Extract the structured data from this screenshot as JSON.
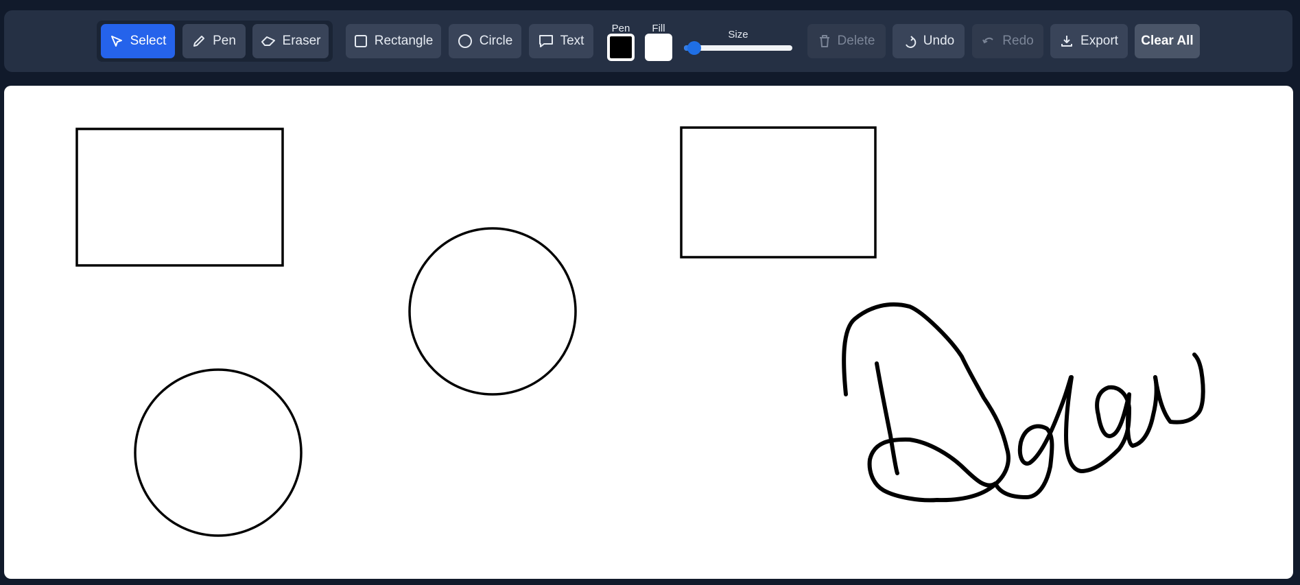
{
  "toolbar": {
    "tools": {
      "select": {
        "label": "Select",
        "icon": "cursor-arrow-icon",
        "active": true
      },
      "pen": {
        "label": "Pen",
        "icon": "pencil-icon"
      },
      "eraser": {
        "label": "Eraser",
        "icon": "eraser-icon"
      }
    },
    "shapes": {
      "rectangle": {
        "label": "Rectangle",
        "icon": "square-icon"
      },
      "circle": {
        "label": "Circle",
        "icon": "circle-icon"
      },
      "text": {
        "label": "Text",
        "icon": "speech-bubble-icon"
      }
    },
    "pen_color": {
      "label": "Pen",
      "value": "#000000"
    },
    "fill_color": {
      "label": "Fill",
      "value": "#ffffff"
    },
    "size": {
      "label": "Size",
      "fraction": 0.08
    },
    "actions": {
      "delete": {
        "label": "Delete",
        "icon": "trash-icon",
        "enabled": false
      },
      "undo": {
        "label": "Undo",
        "icon": "undo-icon",
        "enabled": true
      },
      "redo": {
        "label": "Redo",
        "icon": "redo-icon",
        "enabled": false
      },
      "export": {
        "label": "Export",
        "icon": "download-icon",
        "enabled": true
      },
      "clear_all": {
        "label": "Clear All"
      }
    }
  },
  "colors": {
    "background": "#111a2b",
    "toolbar": "#253044",
    "button": "#394459",
    "active": "#2563eb",
    "canvas": "#ffffff",
    "stroke": "#000000"
  },
  "canvas": {
    "shapes": [
      "rectangle",
      "circle",
      "rectangle",
      "circle",
      "freehand"
    ]
  }
}
